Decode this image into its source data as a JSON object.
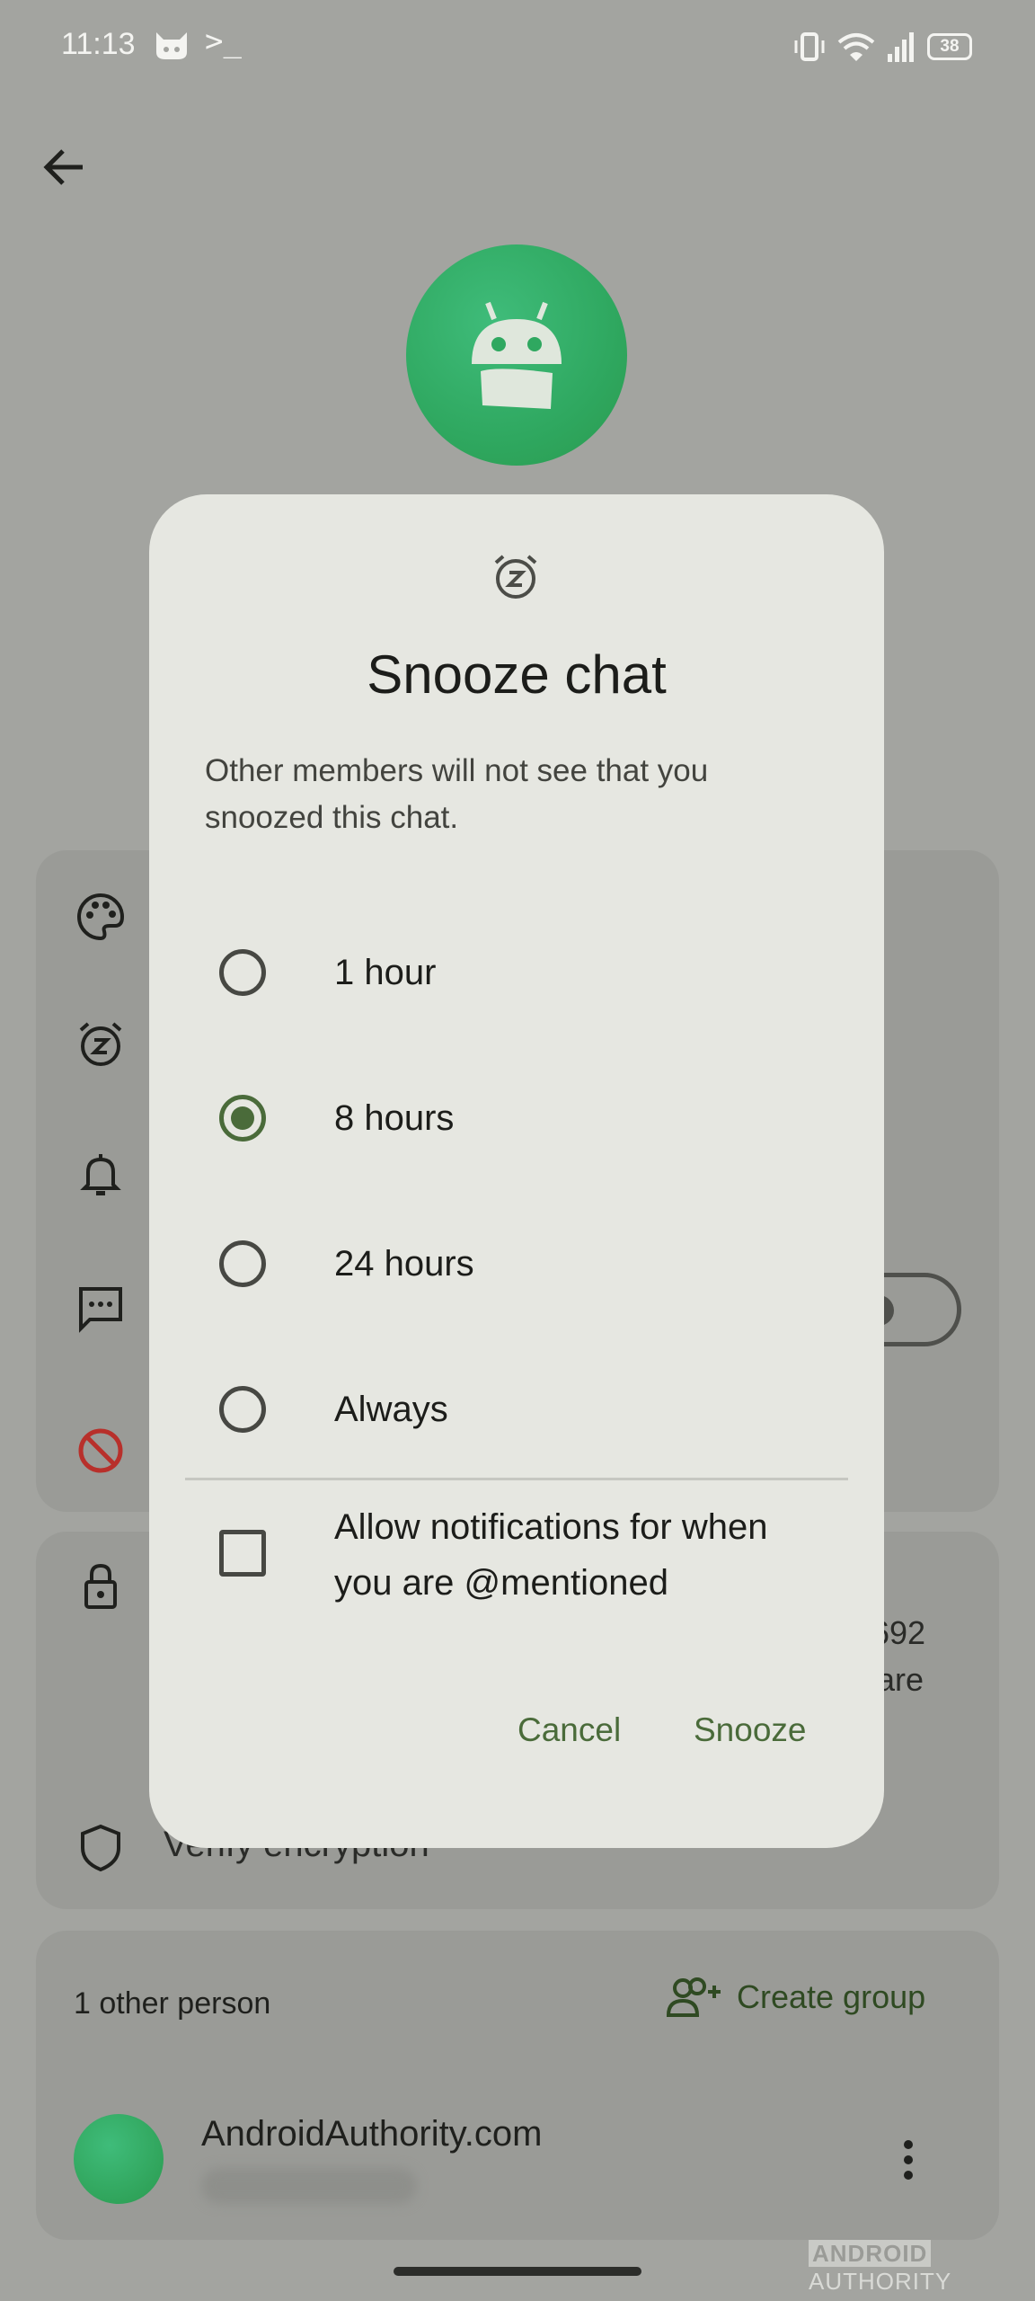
{
  "status_bar": {
    "time": "11:13",
    "terminal_glyph": ">_",
    "battery": "38"
  },
  "background": {
    "partial_number": "692",
    "partial_text": "are",
    "verify_label": "Verify encryption",
    "participants_label": "1 other person",
    "create_group_label": "Create group",
    "contact_name": "AndroidAuthority.com",
    "watermark": {
      "brand": "ANDROID",
      "suffix": "AUTHORITY"
    }
  },
  "dialog": {
    "icon": "snooze-alarm-icon",
    "title": "Snooze chat",
    "body": "Other members will not see that you snoozed this chat.",
    "options": [
      {
        "label": "1 hour",
        "selected": false
      },
      {
        "label": "8 hours",
        "selected": true
      },
      {
        "label": "24 hours",
        "selected": false
      },
      {
        "label": "Always",
        "selected": false
      }
    ],
    "mention_checkbox": {
      "label": "Allow notifications for when you are @mentioned",
      "checked": false
    },
    "cancel_label": "Cancel",
    "snooze_label": "Snooze"
  },
  "colors": {
    "accent": "#4a6b3a",
    "dialog_bg": "#e6e7e1",
    "scrim_bg": "#a3a4a0",
    "avatar_green": "#2fa860"
  }
}
